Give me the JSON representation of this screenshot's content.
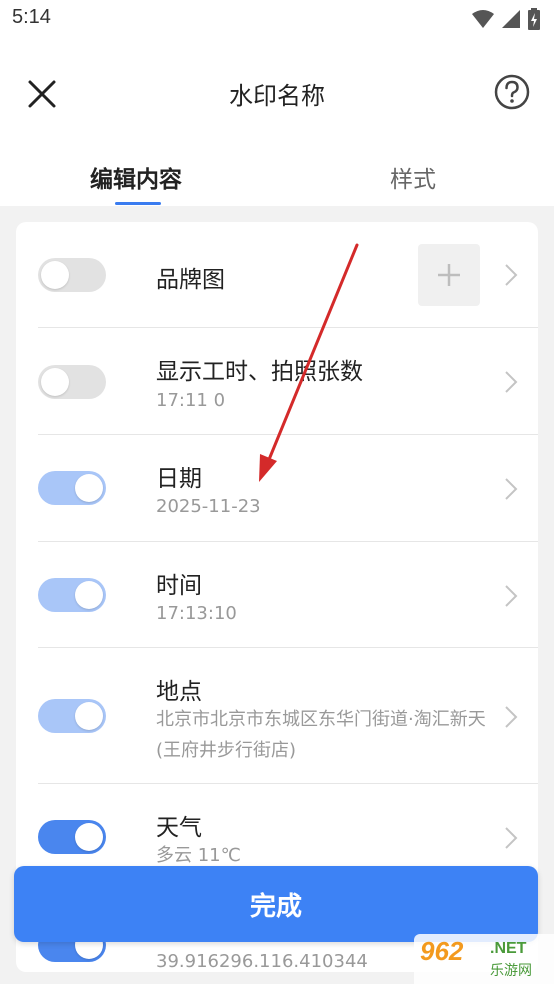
{
  "status": {
    "time": "5:14"
  },
  "header": {
    "title": "水印名称"
  },
  "tabs": [
    {
      "label": "编辑内容",
      "active": true
    },
    {
      "label": "样式",
      "active": false
    }
  ],
  "items": [
    {
      "label": "品牌图",
      "sub": "",
      "enabled": false
    },
    {
      "label": "显示工时、拍照张数",
      "sub": "17:11  0",
      "enabled": false
    },
    {
      "label": "日期",
      "sub": "2025-11-23",
      "enabled": true
    },
    {
      "label": "时间",
      "sub": "17:13:10",
      "enabled": true
    },
    {
      "label": "地点",
      "sub": "北京市北京市东城区东华门街道·淘汇新天(王府井步行街店)",
      "enabled": true
    },
    {
      "label": "天气",
      "sub": "多云 11℃",
      "enabled": true
    },
    {
      "label": "",
      "sub": "39.916296.116.410344",
      "enabled": true
    }
  ],
  "done_button": {
    "label": "完成"
  },
  "watermark_logo": {
    "big": "962",
    "net": ".NET",
    "small": "乐游网"
  },
  "colors": {
    "accent": "#3d82f5",
    "toggle_on": "#4a86ee",
    "toggle_on_light": "#a9c6f8",
    "toggle_off": "#e2e2e2",
    "annotation_arrow": "#d42a2a"
  }
}
